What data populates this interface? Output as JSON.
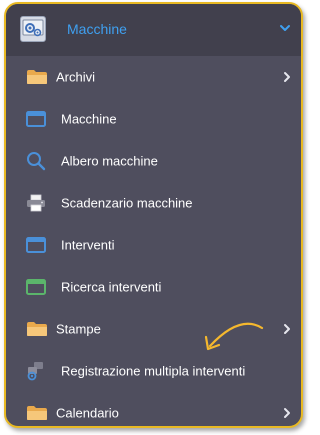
{
  "header": {
    "title": "Macchine",
    "logo_icon": "machines-gear-icon",
    "chevron_icon": "chevron-down-icon",
    "accent_color": "#3fa0f0"
  },
  "colors": {
    "panel_bg": "#4f4e5e",
    "header_bg": "#41404d",
    "border": "#e8b923",
    "folder": "#f0c070",
    "window_blue": "#4a90d9",
    "window_green": "#5bb56b"
  },
  "items": [
    {
      "label": "Archivi",
      "icon": "folder-icon",
      "has_submenu": true
    },
    {
      "label": "Macchine",
      "icon": "window-icon",
      "has_submenu": false
    },
    {
      "label": "Albero macchine",
      "icon": "search-icon",
      "has_submenu": false
    },
    {
      "label": "Scadenzario macchine",
      "icon": "printer-icon",
      "has_submenu": false
    },
    {
      "label": "Interventi",
      "icon": "window-icon",
      "has_submenu": false
    },
    {
      "label": "Ricerca interventi",
      "icon": "window-green-icon",
      "has_submenu": false
    },
    {
      "label": "Stampe",
      "icon": "folder-icon",
      "has_submenu": true
    },
    {
      "label": "Registrazione multipla interventi",
      "icon": "multi-gear-icon",
      "has_submenu": false
    },
    {
      "label": "Calendario",
      "icon": "folder-icon",
      "has_submenu": true
    }
  ],
  "annotation": {
    "icon": "curved-arrow-icon",
    "color": "#f5b82e"
  }
}
